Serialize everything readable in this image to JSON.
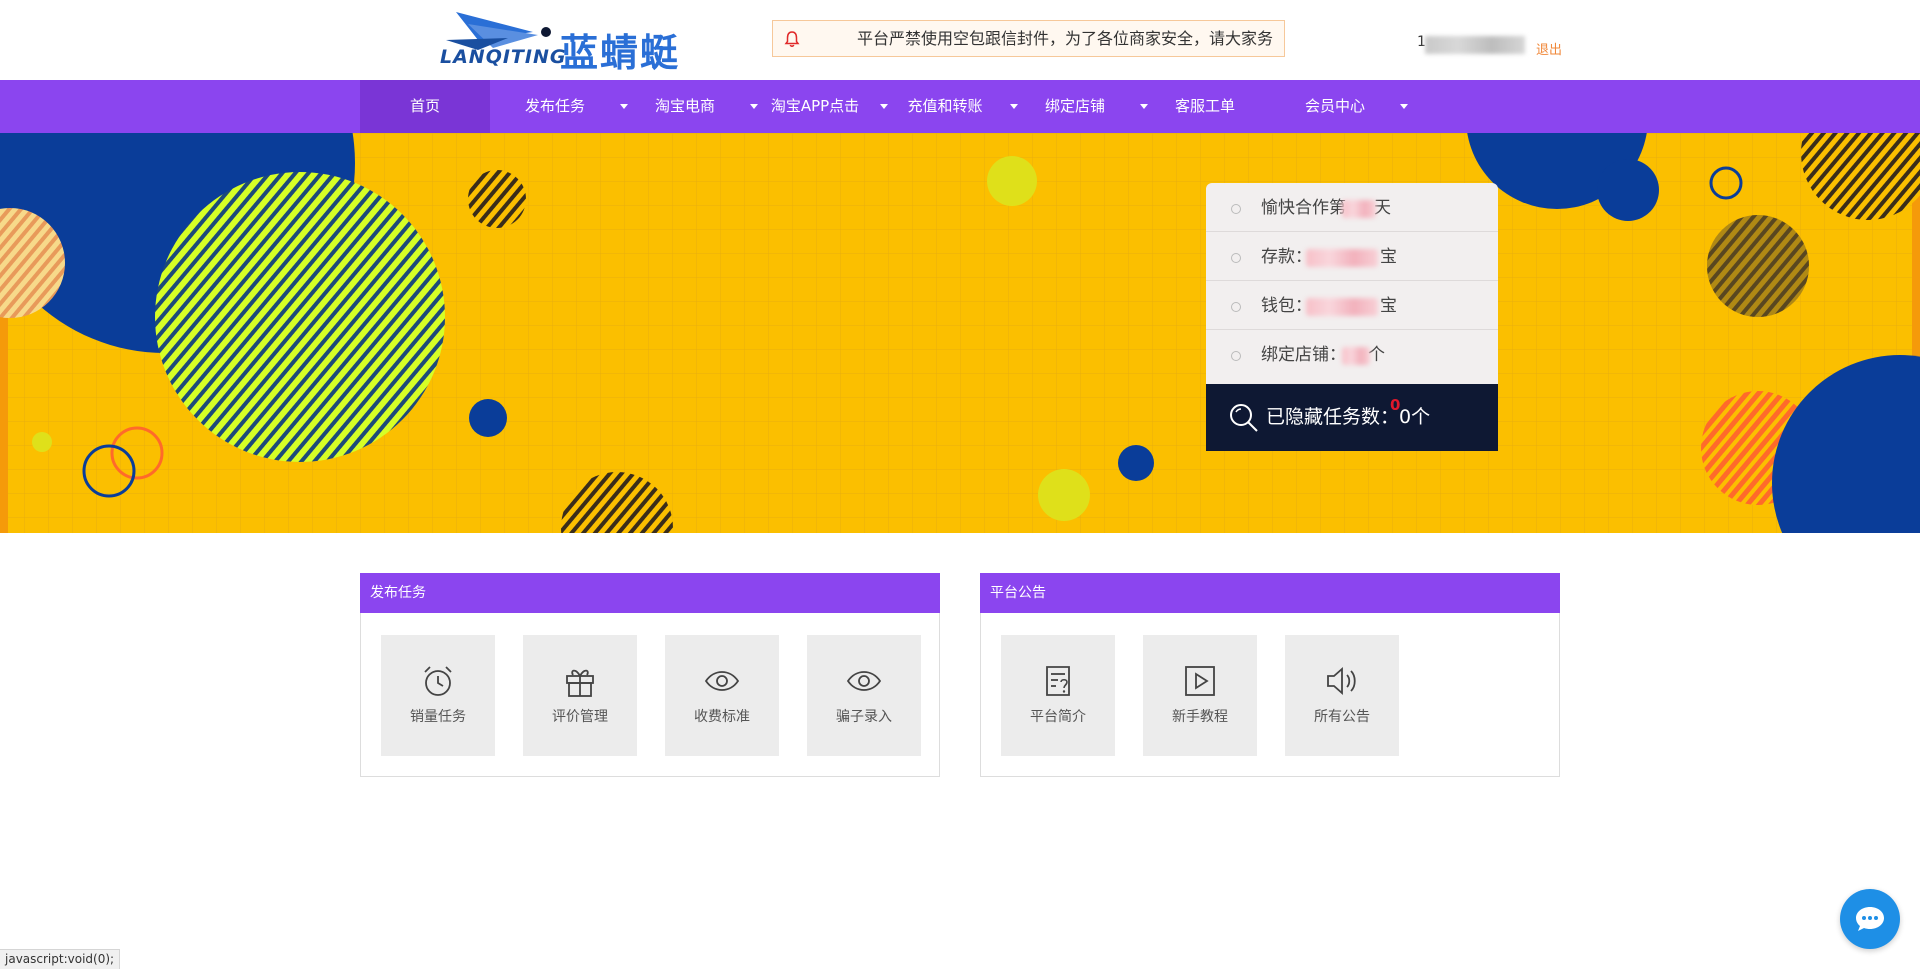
{
  "header": {
    "logo_latin": "LANQITING",
    "logo_cn": "蓝蜻蜓",
    "notice_text": "平台严禁使用空包跟信封件，为了各位商家安全，请大家务",
    "user_name": "1",
    "logout_label": "退出"
  },
  "nav": {
    "items": [
      {
        "label": "首页",
        "active": true,
        "dropdown": false
      },
      {
        "label": "发布任务",
        "active": false,
        "dropdown": true
      },
      {
        "label": "淘宝电商",
        "active": false,
        "dropdown": true
      },
      {
        "label": "淘宝APP点击",
        "active": false,
        "dropdown": true
      },
      {
        "label": "充值和转账",
        "active": false,
        "dropdown": true
      },
      {
        "label": "绑定店铺",
        "active": false,
        "dropdown": true
      },
      {
        "label": "客服工单",
        "active": false,
        "dropdown": false
      },
      {
        "label": "会员中心",
        "active": false,
        "dropdown": true
      }
    ]
  },
  "stats": {
    "rows": [
      {
        "prefix": "愉快合作第",
        "suffix": "天"
      },
      {
        "prefix": "存款：",
        "suffix": "宝"
      },
      {
        "prefix": "钱包：",
        "suffix": "宝"
      },
      {
        "prefix": "绑定店铺：",
        "suffix": "个"
      }
    ],
    "hidden_label": "已隐藏任务数：",
    "hidden_value": "0个",
    "hidden_badge": "0"
  },
  "panels": {
    "publish": {
      "title": "发布任务",
      "tiles": [
        {
          "label": "销量任务",
          "icon": "alarm-clock-icon"
        },
        {
          "label": "评价管理",
          "icon": "gift-icon"
        },
        {
          "label": "收费标准",
          "icon": "eye-icon"
        },
        {
          "label": "骗子录入",
          "icon": "eye-icon"
        }
      ]
    },
    "notice": {
      "title": "平台公告",
      "tiles": [
        {
          "label": "平台简介",
          "icon": "document-question-icon"
        },
        {
          "label": "新手教程",
          "icon": "play-icon"
        },
        {
          "label": "所有公告",
          "icon": "speaker-icon"
        }
      ]
    }
  },
  "status_bar": "javascript:void(0);",
  "colors": {
    "nav_purple": "#8b45ef",
    "banner_yellow": "#fbbf00",
    "navy": "#0e1833",
    "accent_blue": "#1e8fe6",
    "logout_orange": "#f0883a"
  }
}
